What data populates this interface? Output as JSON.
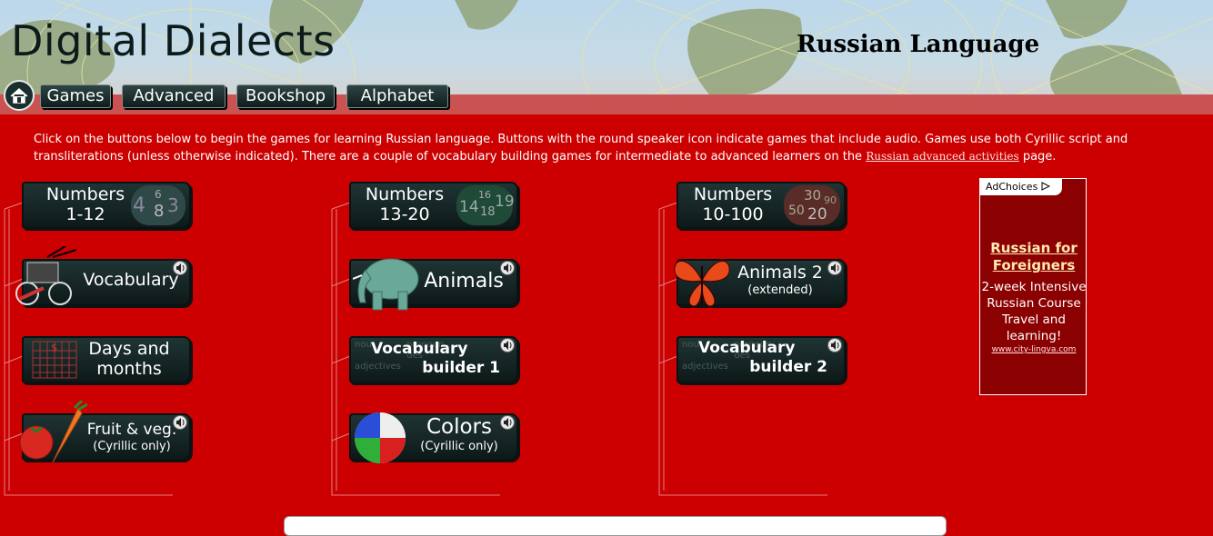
{
  "header": {
    "site_title": "Digital Dialects",
    "language_title": "Russian Language",
    "nav": [
      "Games",
      "Advanced",
      "Bookshop",
      "Alphabet"
    ]
  },
  "intro": {
    "text_before": "Click on the buttons below to begin the games for learning Russian language. Buttons with the round speaker icon indicate games that include audio. Games use both Cyrillic script and transliterations (unless otherwise indicated). There are a couple of vocabulary building games for intermediate to advanced learners on the ",
    "link": "Russian advanced activities",
    "text_after": " page."
  },
  "games": {
    "numbers_1_12": {
      "line1": "Numbers",
      "line2": "1-12",
      "art": [
        "4",
        "6",
        "8",
        "3"
      ]
    },
    "numbers_13_20": {
      "line1": "Numbers",
      "line2": "13-20",
      "art": [
        "14",
        "16",
        "18",
        "19"
      ]
    },
    "numbers_10_100": {
      "line1": "Numbers",
      "line2": "10-100",
      "art": [
        "30",
        "50",
        "90",
        "20"
      ]
    },
    "vocabulary": {
      "line1": "Vocabulary"
    },
    "animals": {
      "line1": "Animals"
    },
    "animals2": {
      "line1": "Animals 2",
      "line2": "(extended)"
    },
    "days_months": {
      "line1": "Days and",
      "line2": "months"
    },
    "vocab_builder1": {
      "line1": "Vocabulary",
      "line2": "builder 1"
    },
    "vocab_builder2": {
      "line1": "Vocabulary",
      "line2": "builder 2"
    },
    "fruit_veg": {
      "line1": "Fruit & veg.",
      "line2": "(Cyrillic only)"
    },
    "colors": {
      "line1": "Colors",
      "line2": "(Cyrillic only)"
    }
  },
  "ad": {
    "choices": "AdChoices",
    "headline": "Russian for Foreigners",
    "body": "2-week Intensive Russian Course Travel and learning!",
    "url": "www.city-lingva.com"
  },
  "colors": {
    "page_bg": "#cc0000",
    "button_bg": "#1a2c2c",
    "ad_bg": "#8b0000"
  }
}
